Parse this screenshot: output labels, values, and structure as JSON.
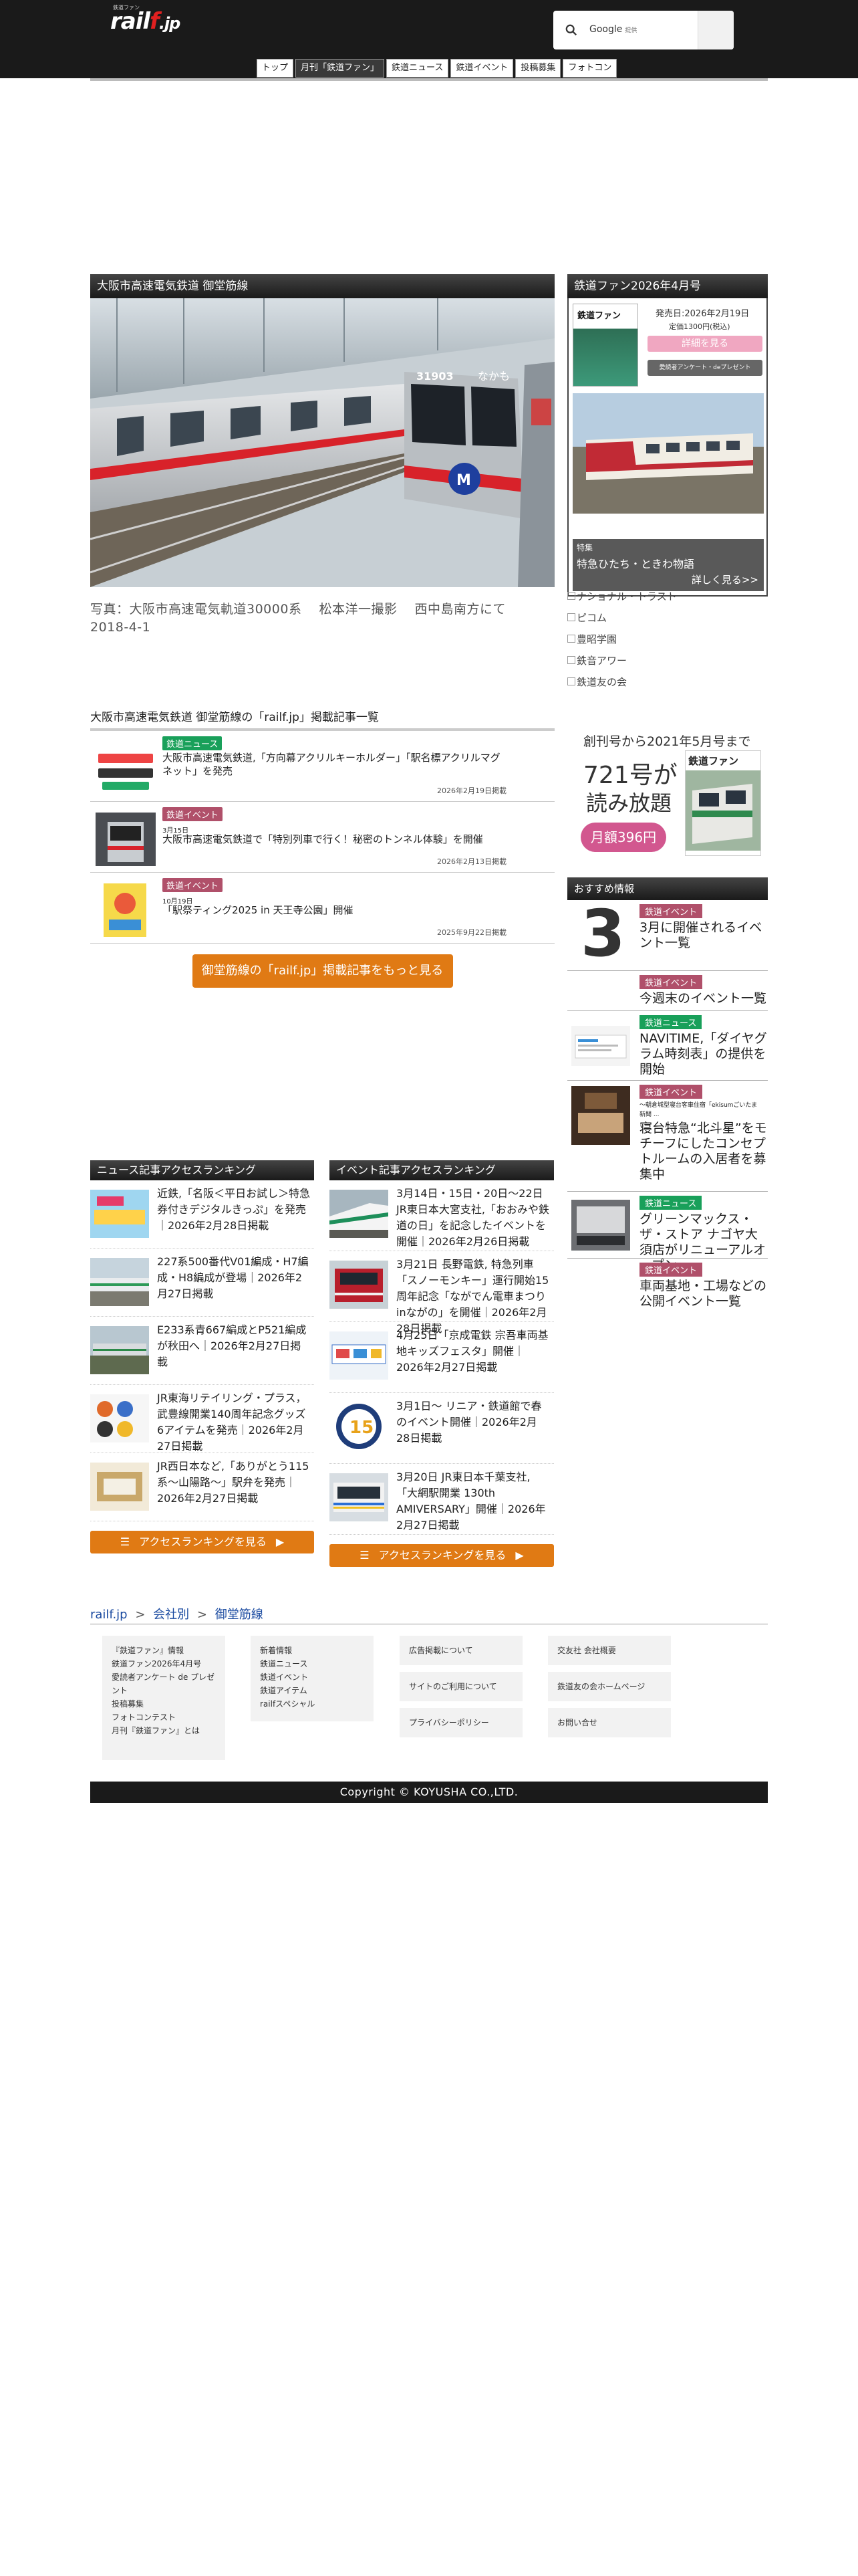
{
  "header": {
    "logo_sub": "鉄道ファン",
    "logo_main_a": "rail",
    "logo_main_f": "f",
    "logo_main_b": ".jp",
    "search_brand": "Google",
    "search_brand_sub": "提供",
    "nav": [
      "トップ",
      "月刊「鉄道ファン」",
      "鉄道ニュース",
      "鉄道イベント",
      "投稿募集",
      "フォトコン"
    ]
  },
  "main": {
    "title": "大阪市高速電気鉄道 御堂筋線",
    "train_number": "31903",
    "train_dest": "なかも",
    "caption": "写真：大阪市高速電気軌道30000系　 松本洋一撮影　 西中島南方にて　2018-4-1"
  },
  "magazine": {
    "header": "鉄道ファン2026年4月号",
    "release": "発売日:2026年2月19日",
    "price": "定価1300円(税込)",
    "buy_button": "詳細を見る",
    "survey_button": "愛読者アンケート・deプレゼント",
    "feature_label": "特集",
    "feature_title": "特急ひたち・ときわ物語",
    "more": "詳しく見る>>",
    "cover_logo": "鉄道ファン"
  },
  "side_links": [
    "ナショナル・トラスト",
    "ピコム",
    "豊昭学園",
    "鉄音アワー",
    "鉄道友の会"
  ],
  "articles": {
    "heading": "大阪市高速電気鉄道 御堂筋線の「railf.jp」掲載記事一覧",
    "items": [
      {
        "tag": "鉄道ニュース",
        "tagcolor": "#19a05a",
        "small": "",
        "title": "大阪市高速電気鉄道,「方向幕アクリルキーホルダー」「駅名標アクリルマグネット」を発売",
        "date": "2026年2月19日掲載"
      },
      {
        "tag": "鉄道イベント",
        "tagcolor": "#b0506a",
        "small": "3月15日",
        "title": "大阪市高速電気鉄道で「特別列車で行く！秘密のトンネル体験」を開催",
        "date": "2026年2月13日掲載"
      },
      {
        "tag": "鉄道イベント",
        "tagcolor": "#b0506a",
        "small": "10月19日",
        "title": "「駅祭ティング2025 in 天王寺公園」開催",
        "date": "2025年9月22日掲載"
      }
    ],
    "more_button": "御堂筋線の「railf.jp」掲載記事をもっと見る"
  },
  "promo": {
    "line1": "創刊号から2021年5月号まで",
    "line2": "721号が",
    "line3": "読み放題",
    "price_button": "月額396円",
    "cover_logo": "鉄道ファン"
  },
  "recommend": {
    "header": "おすすめ情報",
    "items": [
      {
        "tag": "鉄道イベント",
        "tagcolor": "#b0506a",
        "sub": "",
        "title": "3月に開催されるイベント一覧",
        "big": "3"
      },
      {
        "tag": "鉄道イベント",
        "tagcolor": "#b0506a",
        "sub": "",
        "title": "今週末のイベント一覧",
        "big": ""
      },
      {
        "tag": "鉄道ニュース",
        "tagcolor": "#19a05a",
        "sub": "",
        "title": "NAVITIME,「ダイヤグラム時刻表」の提供を開始",
        "big": ""
      },
      {
        "tag": "鉄道イベント",
        "tagcolor": "#b0506a",
        "sub": "〜朝倉城型寝台客車住宿「ekisumごいたま新聞 ...",
        "title": "寝台特急“北斗星”をモチーフにしたコンセプトルームの入居者を募集中",
        "big": ""
      },
      {
        "tag": "鉄道ニュース",
        "tagcolor": "#19a05a",
        "sub": "",
        "title": "グリーンマックス・ザ・ストア ナゴヤ大須店がリニューアルオープン",
        "big": ""
      },
      {
        "tag": "鉄道イベント",
        "tagcolor": "#b0506a",
        "sub": "",
        "title": "車両基地・工場などの公開イベント一覧",
        "big": ""
      }
    ]
  },
  "ranking_news": {
    "header": "ニュース記事アクセスランキング",
    "items": [
      "近鉄,「名阪＜平日お試し＞特急券付きデジタルきっぷ」を発売｜2026年2月28日掲載",
      "227系500番代V01編成・H7編成・H8編成が登場｜2026年2月27日掲載",
      "E233系青667編成とP521編成が秋田へ｜2026年2月27日掲載",
      "JR東海リテイリング・プラス，武豊線開業140周年記念グッズ6アイテムを発売｜2026年2月27日掲載",
      "JR西日本など,「ありがとう115系〜山陽路〜」駅弁を発売｜2026年2月27日掲載"
    ],
    "button": "アクセスランキングを見る"
  },
  "ranking_event": {
    "header": "イベント記事アクセスランキング",
    "items": [
      "3月14日・15日・20日〜22日　JR東日本大宮支社,「おおみや鉄道の日」を記念したイベントを開催｜2026年2月26日掲載",
      "3月21日 長野電鉄, 特急列車「スノーモンキー」運行開始15周年記念「ながでん電車まつりinながの」を開催｜2026年2月28日掲載",
      "4月25日「京成電鉄 宗吾車両基地キッズフェスタ」開催｜2026年2月27日掲載",
      "3月1日〜 リニア・鉄道館で春のイベント開催｜2026年2月28日掲載",
      "3月20日 JR東日本千葉支社,「大網駅開業 130th AMIVERSARY」開催｜2026年2月27日掲載"
    ],
    "button": "アクセスランキングを見る"
  },
  "breadcrumb": {
    "home": "railf.jp",
    "sep": ">",
    "level1": "会社別",
    "level2": "御堂筋線"
  },
  "footer": {
    "col1": [
      "『鉄道ファン』情報",
      "鉄道ファン2026年4月号",
      "愛読者アンケート de プレゼント",
      "投稿募集",
      "フォトコンテスト",
      "月刊『鉄道ファン』とは"
    ],
    "col2": [
      "新着情報",
      "鉄道ニュース",
      "鉄道イベント",
      "鉄道アイテム",
      "railfスペシャル"
    ],
    "col3": [
      "広告掲載について",
      "サイトのご利用について",
      "プライバシーポリシー"
    ],
    "col4": [
      "交友社 会社概要",
      "鉄道友の会ホームページ",
      "お問い合せ"
    ],
    "copyright": "Copyright © KOYUSHA CO.,LTD."
  },
  "colors": {
    "accent": "#e07a14",
    "news_tag": "#19a05a",
    "event_tag": "#b0506a",
    "header_bg": "#1a1a1a"
  }
}
